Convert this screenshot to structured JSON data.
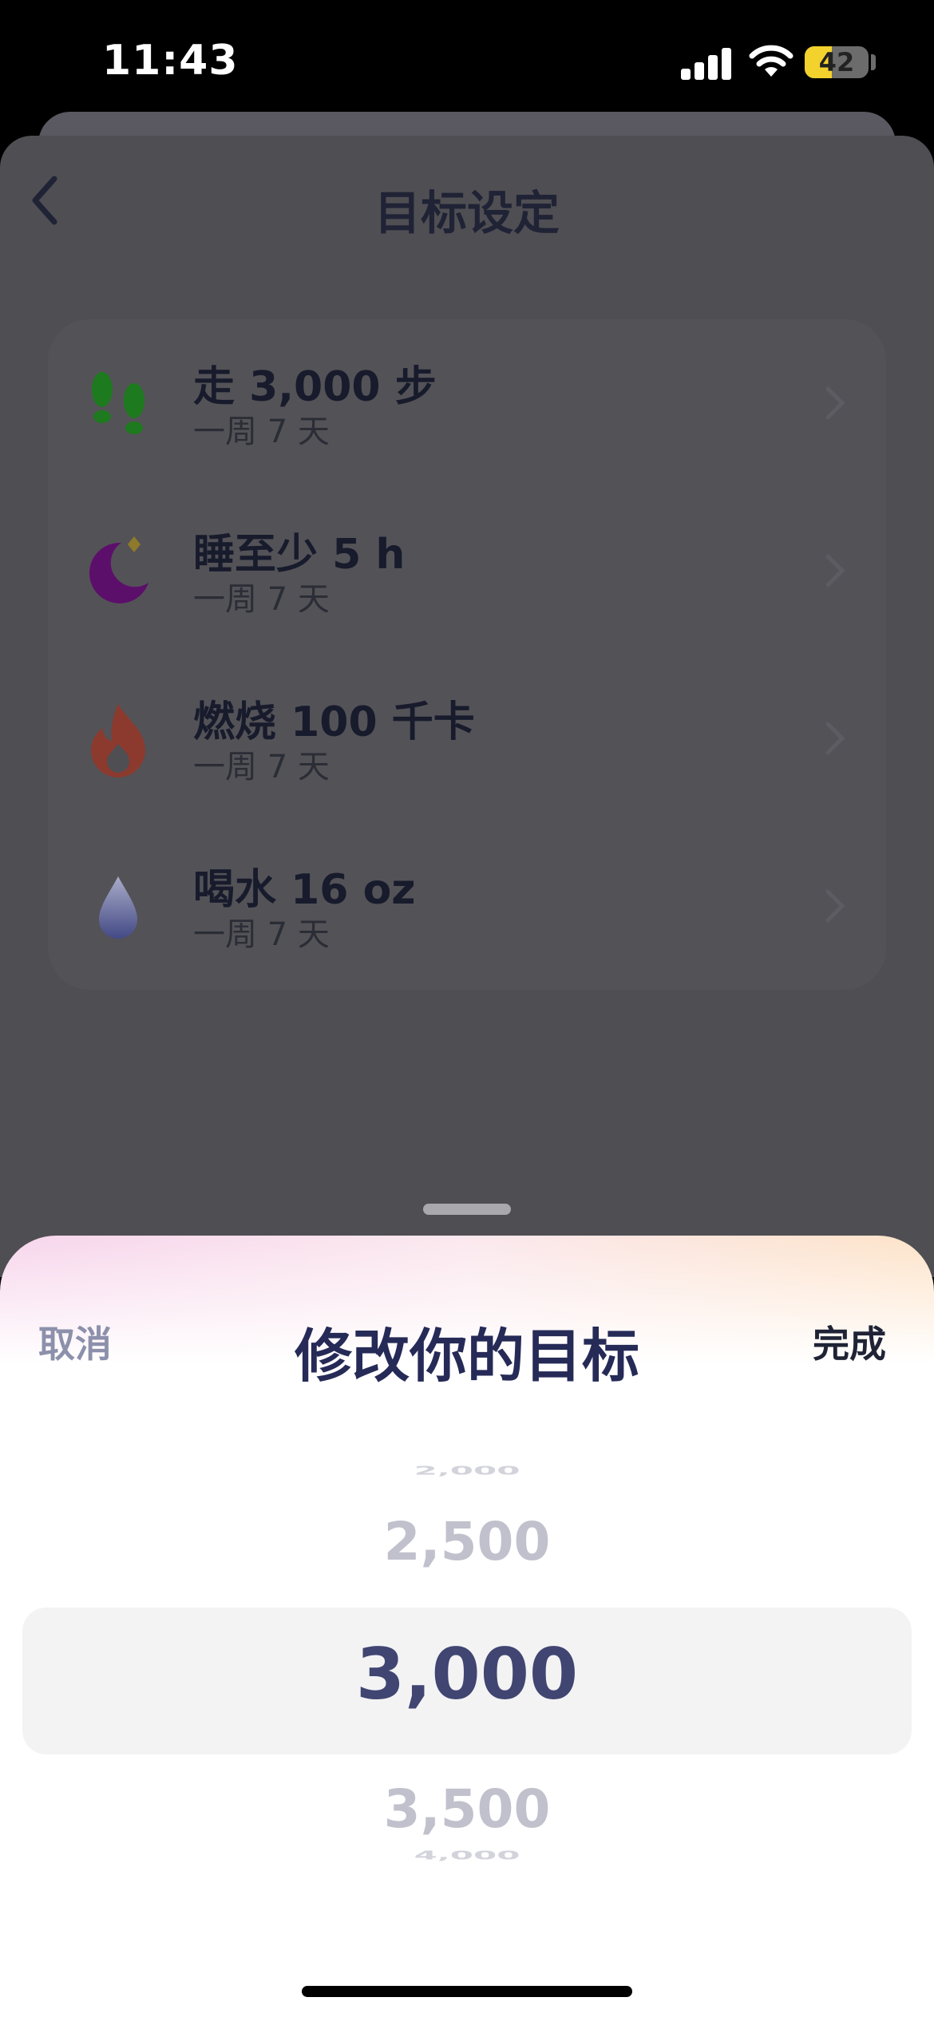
{
  "status_bar": {
    "time": "11:43",
    "battery_level": "42",
    "battery_percent": 42
  },
  "page": {
    "title": "目标设定",
    "goals": [
      {
        "title": "走 3,000 步",
        "subtitle": "一周 7 天",
        "icon": "footprints-icon",
        "color": "#1e7a1e"
      },
      {
        "title": "睡至少 5 h",
        "subtitle": "一周 7 天",
        "icon": "moon-icon",
        "color": "#5c0f6a"
      },
      {
        "title": "燃烧 100 千卡",
        "subtitle": "一周 7 天",
        "icon": "flame-icon",
        "color": "#8c3a2e"
      },
      {
        "title": "喝水 16 oz",
        "subtitle": "一周 7 天",
        "icon": "water-drop-icon",
        "color": "#545a8e"
      }
    ]
  },
  "sheet": {
    "cancel_label": "取消",
    "title": "修改你的目标",
    "done_label": "完成",
    "picker": {
      "options": [
        "2,000",
        "2,500",
        "3,000",
        "3,500",
        "4,000"
      ],
      "selected": "3,000"
    }
  }
}
